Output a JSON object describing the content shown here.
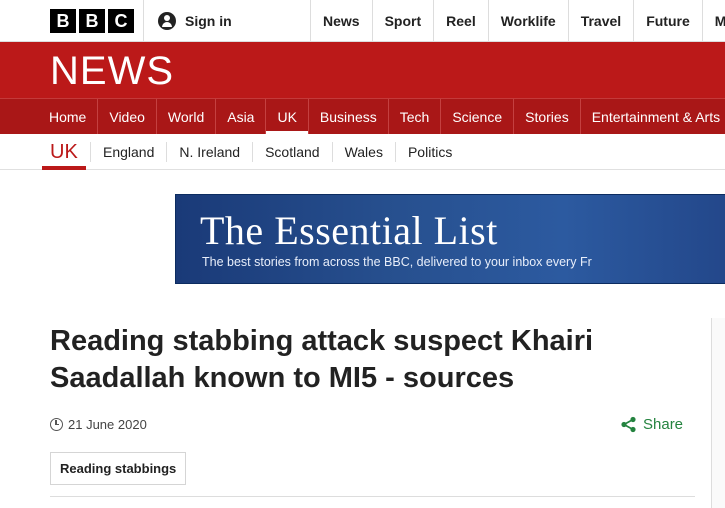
{
  "brand": {
    "letters": [
      "B",
      "B",
      "C"
    ]
  },
  "topbar": {
    "signin_label": "Sign in",
    "nav": [
      "News",
      "Sport",
      "Reel",
      "Worklife",
      "Travel",
      "Future",
      "More"
    ]
  },
  "masthead": {
    "title": "NEWS"
  },
  "mainnav": {
    "items": [
      "Home",
      "Video",
      "World",
      "Asia",
      "UK",
      "Business",
      "Tech",
      "Science",
      "Stories",
      "Entertainment & Arts"
    ],
    "active": "UK"
  },
  "subnav": {
    "title": "UK",
    "items": [
      "England",
      "N. Ireland",
      "Scotland",
      "Wales",
      "Politics"
    ]
  },
  "banner": {
    "title": "The Essential List",
    "subtitle": "The best stories from across the BBC, delivered to your inbox every Fr"
  },
  "article": {
    "headline": "Reading stabbing attack suspect Khairi Saadallah known to MI5 - sources",
    "date": "21 June 2020",
    "share_label": "Share",
    "tag": "Reading stabbings"
  },
  "colors": {
    "brand_red": "#bb1919",
    "nav_red": "#a91717",
    "share_green": "#24833f"
  }
}
